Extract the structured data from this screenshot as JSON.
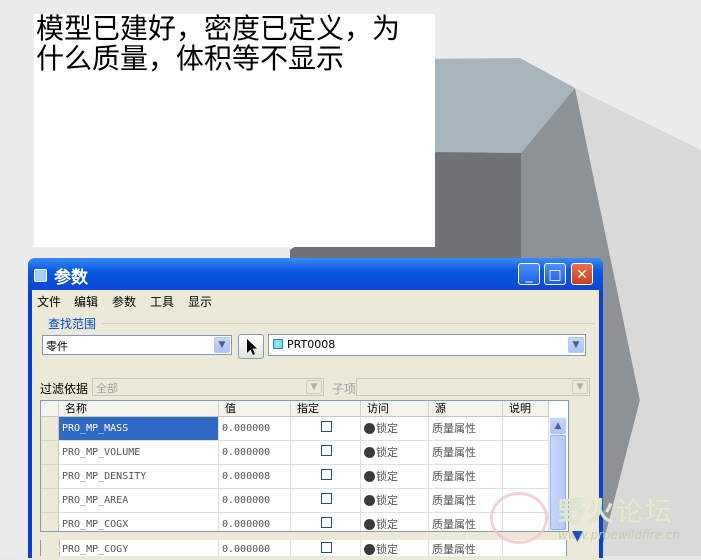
{
  "note": {
    "line1": "模型已建好，密度已定义，为",
    "line2": "什么质量，体积等不显示"
  },
  "window": {
    "title": "参数",
    "minimize": "_",
    "maximize": "□",
    "close": "✕"
  },
  "menu": [
    "文件",
    "编辑",
    "参数",
    "工具",
    "显示"
  ],
  "scope": {
    "label": "查找范围",
    "type_value": "零件",
    "object_value": "PRT0008"
  },
  "filter": {
    "label": "过滤依据",
    "value": "全部",
    "sub_label": "子项",
    "sub_value": ""
  },
  "table": {
    "columns": [
      "名称",
      "值",
      "指定",
      "访问",
      "源",
      "说明"
    ],
    "rows": [
      {
        "name": "PRO_MP_MASS",
        "value": "0.000000",
        "access": "锁定",
        "source": "质量属性"
      },
      {
        "name": "PRO_MP_VOLUME",
        "value": "0.000000",
        "access": "锁定",
        "source": "质量属性"
      },
      {
        "name": "PRO_MP_DENSITY",
        "value": "0.000008",
        "access": "锁定",
        "source": "质量属性"
      },
      {
        "name": "PRO_MP_AREA",
        "value": "0.000000",
        "access": "锁定",
        "source": "质量属性"
      },
      {
        "name": "PRO_MP_COGX",
        "value": "0.000000",
        "access": "锁定",
        "source": "质量属性"
      },
      {
        "name": "PRO_MP_COGY",
        "value": "0.000000",
        "access": "锁定",
        "source": "质量属性"
      }
    ]
  },
  "watermark": {
    "text": "野火论坛",
    "url": "www.proewildfire.cn"
  },
  "icons": {
    "pointer": "arrow-pointer-icon",
    "lock": "lock-icon",
    "part": "part-icon"
  },
  "colors": {
    "title_bar": "#0b58e0",
    "selection": "#316ac5",
    "window_bg": "#ece9d8"
  }
}
